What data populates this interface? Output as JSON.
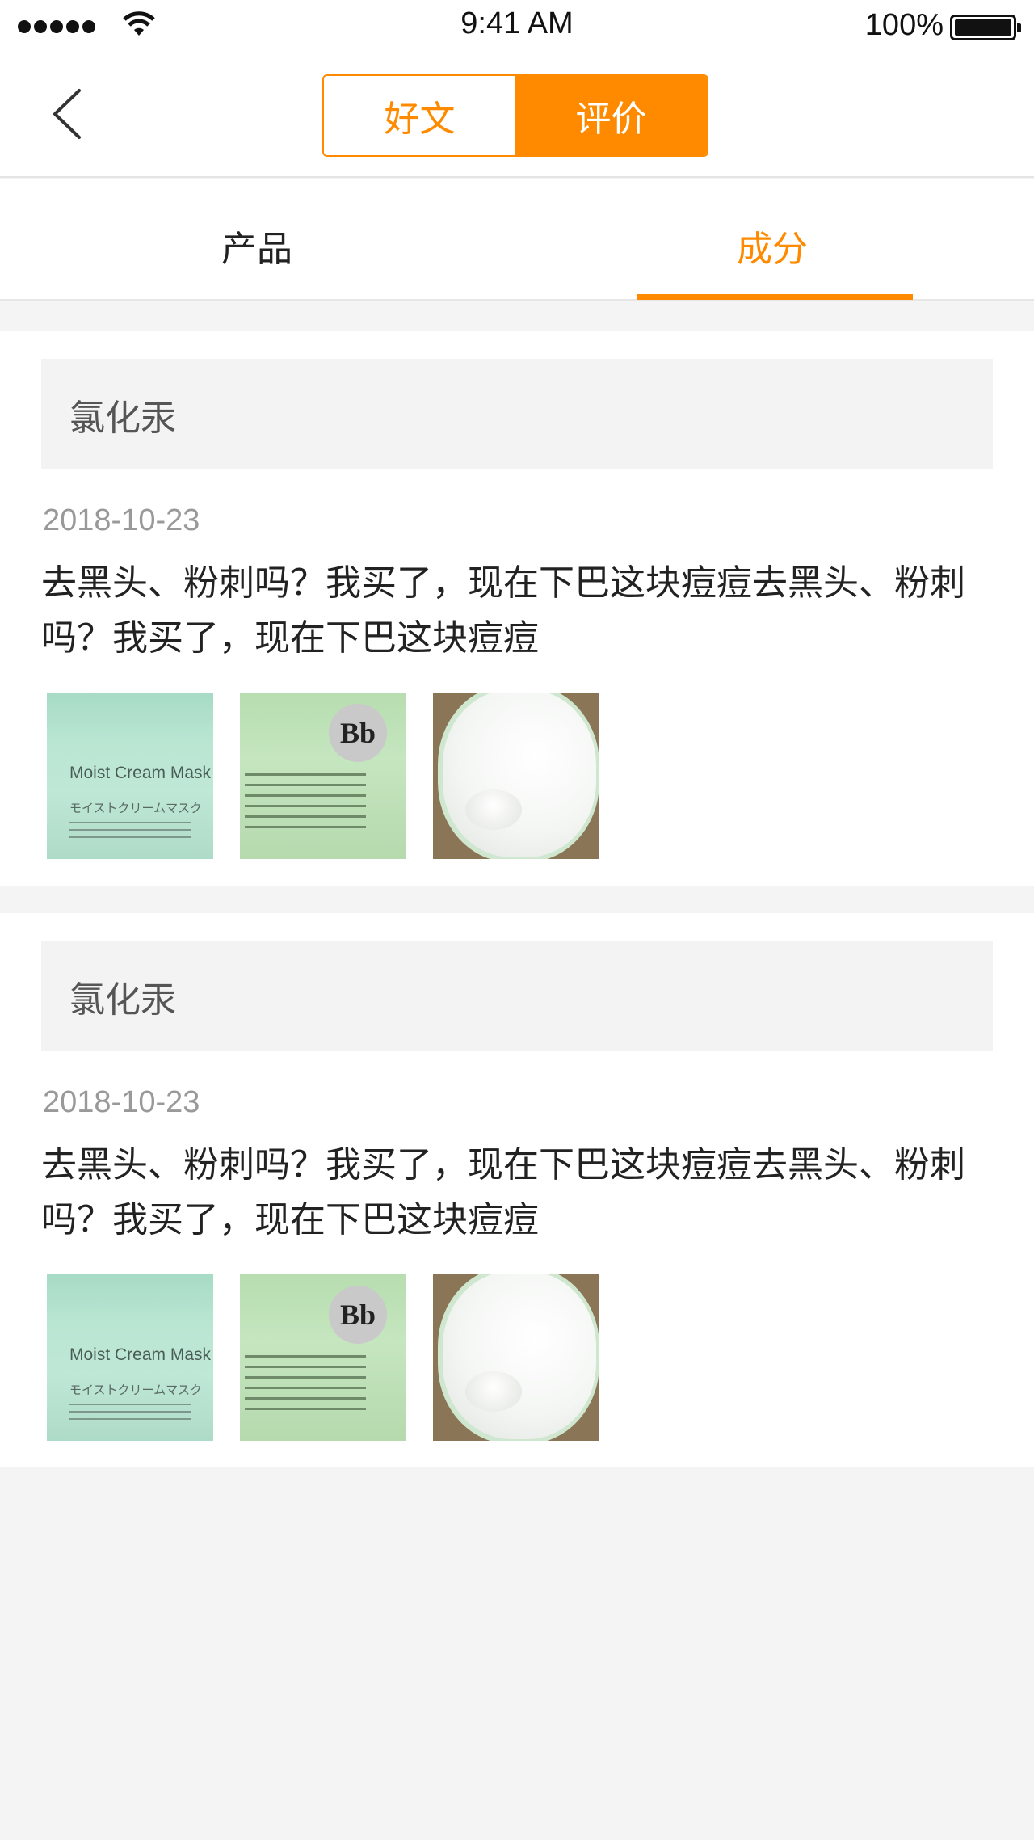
{
  "status_bar": {
    "time": "9:41 AM",
    "battery": "100%"
  },
  "nav": {
    "segments": [
      {
        "label": "好文",
        "active": false
      },
      {
        "label": "评价",
        "active": true
      }
    ]
  },
  "tabs": [
    {
      "label": "产品",
      "active": false
    },
    {
      "label": "成分",
      "active": true
    }
  ],
  "colors": {
    "accent": "#ff8a00",
    "background": "#f4f4f4"
  },
  "reviews": [
    {
      "title": "氯化汞",
      "date": "2018-10-23",
      "text": "去黑头、粉刺吗？我买了，现在下巴这块痘痘去黑头、粉刺吗？我买了，现在下巴这块痘痘",
      "images": [
        {
          "caption_1": "Moist Cream Mask Pro.",
          "caption_2": "モイストクリームマスク"
        },
        {
          "logo": "Bb"
        },
        {}
      ]
    },
    {
      "title": "氯化汞",
      "date": "2018-10-23",
      "text": "去黑头、粉刺吗？我买了，现在下巴这块痘痘去黑头、粉刺吗？我买了，现在下巴这块痘痘",
      "images": [
        {
          "caption_1": "Moist Cream Mask Pro.",
          "caption_2": "モイストクリームマスク"
        },
        {
          "logo": "Bb"
        },
        {}
      ]
    }
  ]
}
